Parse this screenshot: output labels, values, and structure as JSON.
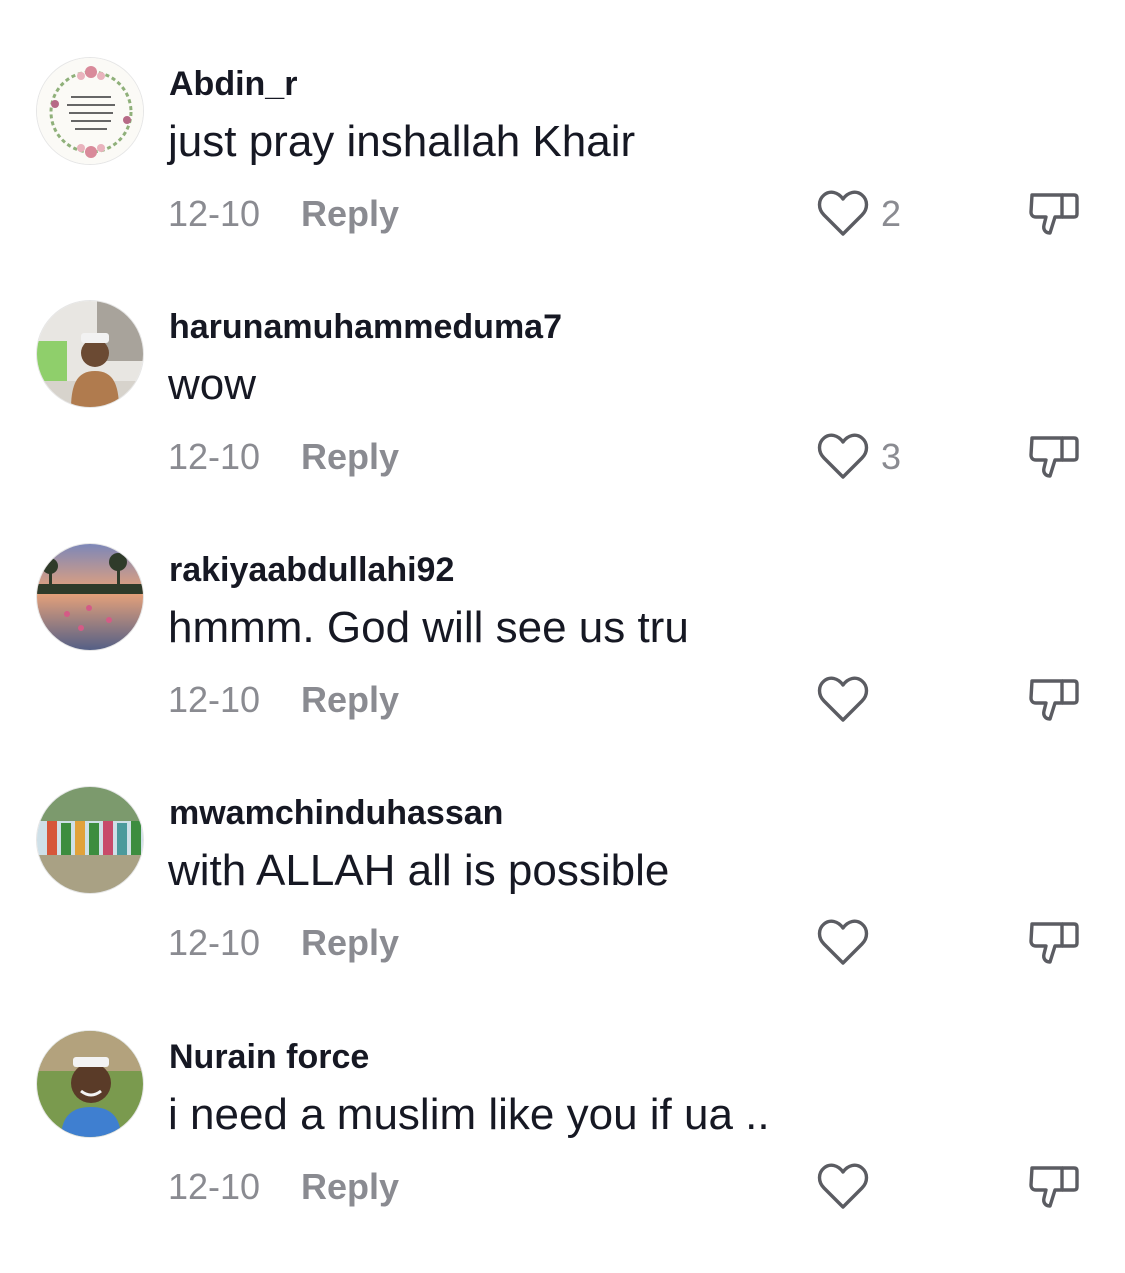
{
  "comments": [
    {
      "username": "Abdin_r",
      "text": "just pray inshallah Khair",
      "date": "12-10",
      "reply_label": "Reply",
      "like_count": "2",
      "avatar": "floral-arabic-calligraphy-avatar"
    },
    {
      "username": "harunamuhammeduma7",
      "text": "wow",
      "date": "12-10",
      "reply_label": "Reply",
      "like_count": "3",
      "avatar": "man-in-cap-photo-avatar"
    },
    {
      "username": "rakiyaabdullahi92",
      "text": "hmmm. God will see us tru",
      "date": "12-10",
      "reply_label": "Reply",
      "like_count": "",
      "avatar": "sunset-lake-photo-avatar"
    },
    {
      "username": "mwamchinduhassan",
      "text": "with ALLAH all is possible",
      "date": "12-10",
      "reply_label": "Reply",
      "like_count": "",
      "avatar": "crowd-outdoor-photo-avatar"
    },
    {
      "username": "Nurain force",
      "text": "i need a muslim like you if ua ..",
      "date": "12-10",
      "reply_label": "Reply",
      "like_count": "",
      "avatar": "smiling-man-photo-avatar"
    }
  ],
  "icons": {
    "like": "heart-outline-icon",
    "dislike": "thumbs-down-outline-icon"
  },
  "colors": {
    "primary_text": "#161823",
    "secondary_text": "#8a8b91",
    "background": "#ffffff"
  }
}
